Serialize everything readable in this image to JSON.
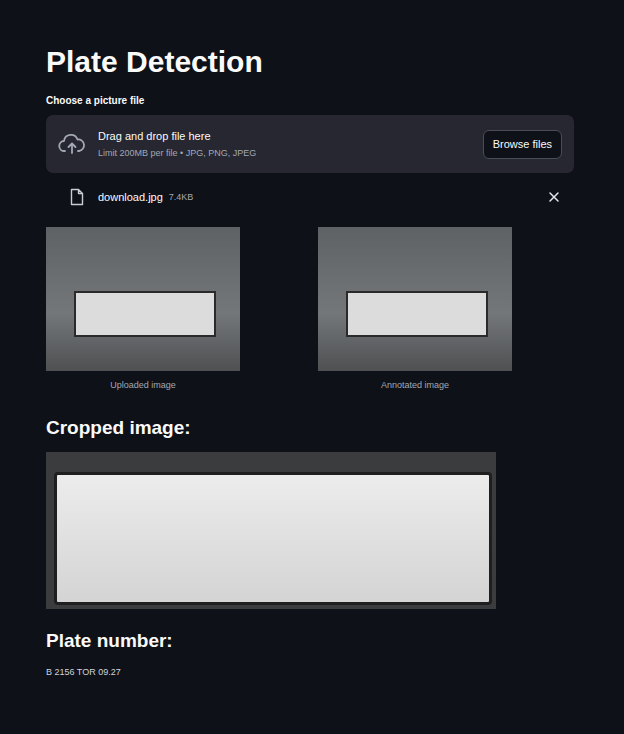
{
  "page": {
    "title": "Plate Detection"
  },
  "uploader": {
    "label": "Choose a picture file",
    "prompt": "Drag and drop file here",
    "limits": "Limit 200MB per file • JPG, PNG, JPEG",
    "button": "Browse files"
  },
  "file": {
    "name": "download.jpg",
    "size": "7.4KB"
  },
  "images": [
    {
      "caption": "Uploaded image"
    },
    {
      "caption": "Annotated image"
    }
  ],
  "cropped": {
    "heading": "Cropped image:"
  },
  "result": {
    "heading": "Plate number:",
    "text": "B 2156 TOR 09.27"
  }
}
